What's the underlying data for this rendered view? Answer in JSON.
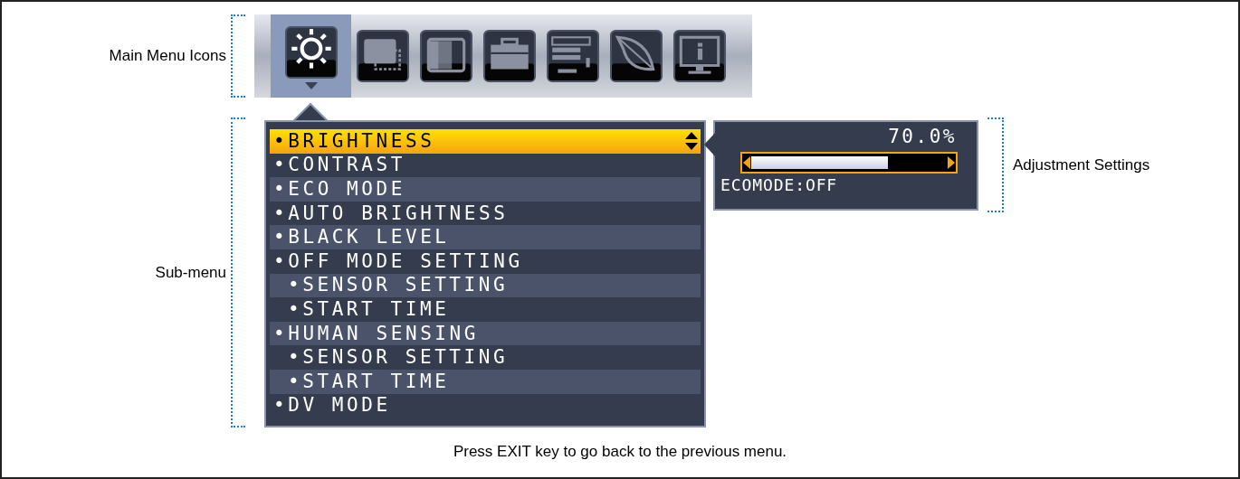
{
  "labels": {
    "main_menu": "Main Menu Icons",
    "sub_menu": "Sub-menu",
    "adjustment": "Adjustment Settings"
  },
  "main_menu_icons": [
    {
      "selected": true
    },
    {
      "selected": false
    },
    {
      "selected": false
    },
    {
      "selected": false
    },
    {
      "selected": false
    },
    {
      "selected": false
    },
    {
      "selected": false
    }
  ],
  "sub_menu": [
    {
      "label": "•BRIGHTNESS",
      "selected": true
    },
    {
      "label": "•CONTRAST",
      "selected": false
    },
    {
      "label": "•ECO MODE",
      "selected": false
    },
    {
      "label": "•AUTO BRIGHTNESS",
      "selected": false
    },
    {
      "label": "•BLACK LEVEL",
      "selected": false
    },
    {
      "label": "•OFF MODE SETTING",
      "selected": false,
      "children": [
        {
          "label": "•SENSOR SETTING",
          "selected": false
        },
        {
          "label": "•START TIME",
          "selected": false
        }
      ]
    },
    {
      "label": "•HUMAN SENSING",
      "selected": false,
      "children": [
        {
          "label": "•SENSOR SETTING",
          "selected": false
        },
        {
          "label": "•START TIME",
          "selected": false
        }
      ]
    },
    {
      "label": "•DV MODE",
      "selected": false
    }
  ],
  "adjustment": {
    "reading": "70.0%",
    "level": 0.7,
    "status": "ECOMODE:OFF"
  },
  "footer": "Press EXIT key to go back to the previous menu."
}
